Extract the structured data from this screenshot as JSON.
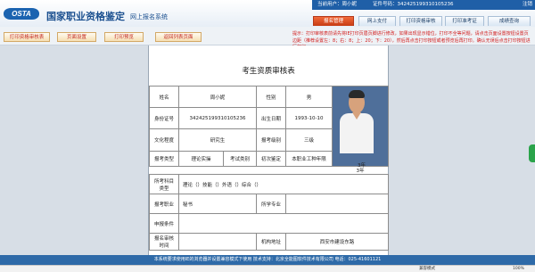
{
  "header": {
    "logo_text": "OSTA",
    "title": "国家职业资格鉴定",
    "subtitle": "网上报名系统",
    "user_bar": {
      "welcome": "当前用户：周小妮",
      "cert_no": "证件号码：342425199310105236",
      "logout": "注销"
    },
    "nav_tabs": [
      {
        "label": "报名管理",
        "active": true
      },
      {
        "label": "网上支付",
        "active": false
      },
      {
        "label": "打印资格审核",
        "active": false
      },
      {
        "label": "打印准考证",
        "active": false
      },
      {
        "label": "成绩查询",
        "active": false
      }
    ]
  },
  "toolbar": {
    "buttons": [
      "打印资格审核表",
      "页面设置",
      "打印预览",
      "返回列表页面"
    ]
  },
  "notice": "提示：打印审核表前请先将IE打印页眉页脚进行修改，如果出现显示错位，打印不全等问题，请点击页面设置按钮设置页边距（推荐设置左：8；右：8；上：20；下：20），然后再点击打印按钮或者预览后再打印。确认无误后点击打印按钮进行打印",
  "form": {
    "title": "考生资质审核表",
    "name_label": "姓名",
    "name_value": "周小妮",
    "gender_label": "性别",
    "gender_value": "男",
    "id_label": "身份证号",
    "id_value": "342425199310105236",
    "birth_label": "出生日期",
    "birth_value": "1993-10-10",
    "edu_label": "文化程度",
    "edu_value": "研究生",
    "level_label": "报考级别",
    "level_value": "三级",
    "type_label": "报考类型",
    "type_value": "理论实操",
    "exam_cat_label": "考试类别",
    "exam_cat_value": "初次鉴定",
    "work_years_label": "本职业工种年限",
    "work_years_value": "3年",
    "subjects_label": "所考科目",
    "subjects_label2": "类型",
    "subjects_value": "理论（）技能（）外语（）综合（）",
    "job_label": "报考职业",
    "job_value": "秘书",
    "major_label": "所学专业",
    "major_value": "",
    "condition_label": "申报条件",
    "condition_value": "",
    "org_label": "报名审核",
    "org_label2": "时间",
    "addr_label": "机构地址",
    "addr_value": "西安市建设东路"
  },
  "footer": {
    "text": "本系统要求使用IE的浏览器并设置兼容模式下使用  技术支持：北京全能图软件技术有限公司  电话：025-41601121"
  },
  "statusbar": {
    "compat": "兼容模式",
    "zoom": "100%"
  },
  "colors": {
    "brand_blue": "#1f5fa7",
    "active_tab": "#d94a1f",
    "notice_red": "#d21d1d"
  }
}
